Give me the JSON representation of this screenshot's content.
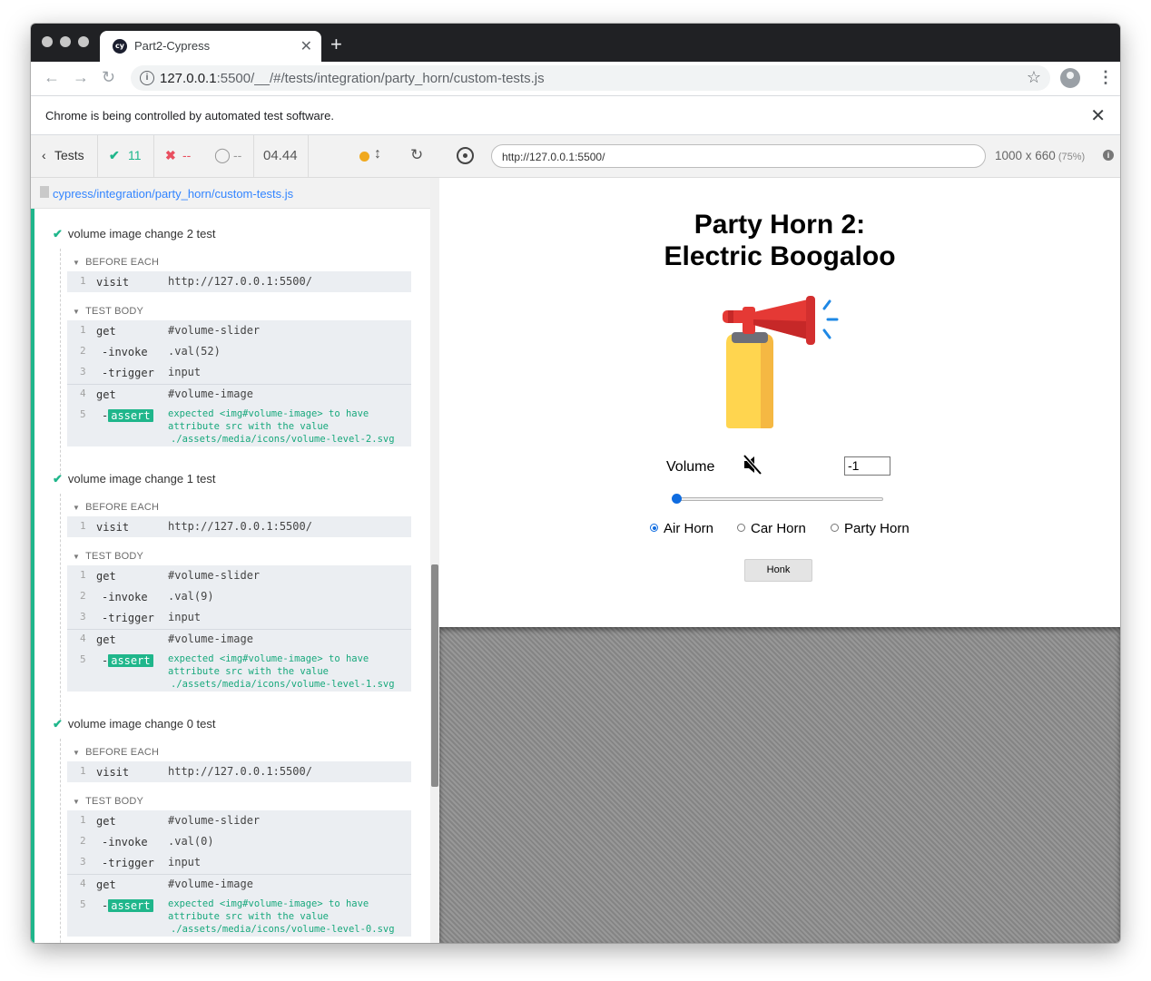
{
  "browser": {
    "tab_title": "Part2-Cypress",
    "tab_favicon": "cy",
    "url_host": "127.0.0.1",
    "url_rest": ":5500/__/#/tests/integration/party_horn/custom-tests.js",
    "infobar_text": "Chrome is being controlled by automated test software."
  },
  "reporter": {
    "back_label": "Tests",
    "passed": "11",
    "failed": "--",
    "pending": "--",
    "duration": "04.44",
    "spec_path": "cypress/integration/party_horn/custom-tests.js",
    "tests": [
      {
        "title": "volume image change 2 test",
        "before_each_label": "BEFORE EACH",
        "before_each": [
          {
            "num": "1",
            "name": "visit",
            "msg": "http://127.0.0.1:5500/"
          }
        ],
        "test_body_label": "TEST BODY",
        "body": [
          {
            "num": "1",
            "name": "get",
            "msg": "#volume-slider"
          },
          {
            "num": "2",
            "name": "-invoke",
            "msg": ".val(52)"
          },
          {
            "num": "3",
            "name": "-trigger",
            "msg": "input"
          },
          {
            "num": "4",
            "name": "get",
            "msg": "#volume-image"
          }
        ],
        "assert": {
          "num": "5",
          "dash": "-",
          "label": "assert",
          "line1": "expected <img#volume-image> to have",
          "line2": "attribute src with the value",
          "line3": "./assets/media/icons/volume-level-2.svg"
        }
      },
      {
        "title": "volume image change 1 test",
        "before_each_label": "BEFORE EACH",
        "before_each": [
          {
            "num": "1",
            "name": "visit",
            "msg": "http://127.0.0.1:5500/"
          }
        ],
        "test_body_label": "TEST BODY",
        "body": [
          {
            "num": "1",
            "name": "get",
            "msg": "#volume-slider"
          },
          {
            "num": "2",
            "name": "-invoke",
            "msg": ".val(9)"
          },
          {
            "num": "3",
            "name": "-trigger",
            "msg": "input"
          },
          {
            "num": "4",
            "name": "get",
            "msg": "#volume-image"
          }
        ],
        "assert": {
          "num": "5",
          "dash": "-",
          "label": "assert",
          "line1": "expected <img#volume-image> to have",
          "line2": "attribute src with the value",
          "line3": "./assets/media/icons/volume-level-1.svg"
        }
      },
      {
        "title": "volume image change 0 test",
        "before_each_label": "BEFORE EACH",
        "before_each": [
          {
            "num": "1",
            "name": "visit",
            "msg": "http://127.0.0.1:5500/"
          }
        ],
        "test_body_label": "TEST BODY",
        "body": [
          {
            "num": "1",
            "name": "get",
            "msg": "#volume-slider"
          },
          {
            "num": "2",
            "name": "-invoke",
            "msg": ".val(0)"
          },
          {
            "num": "3",
            "name": "-trigger",
            "msg": "input"
          },
          {
            "num": "4",
            "name": "get",
            "msg": "#volume-image"
          }
        ],
        "assert": {
          "num": "5",
          "dash": "-",
          "label": "assert",
          "line1": "expected <img#volume-image> to have",
          "line2": "attribute src with the value",
          "line3": "./assets/media/icons/volume-level-0.svg"
        }
      }
    ]
  },
  "aut": {
    "url": "http://127.0.0.1:5500/",
    "viewport": "1000 x 660",
    "scale": "(75%)",
    "title_line1": "Party Horn 2:",
    "title_line2": "Electric Boogaloo",
    "volume_label": "Volume",
    "volume_value": "-1",
    "slider_level": 0,
    "horn_options": [
      "Air Horn",
      "Car Horn",
      "Party Horn"
    ],
    "selected_horn": "Air Horn",
    "honk_label": "Honk"
  },
  "colors": {
    "pass_green": "#1fb68b",
    "fail_red": "#e94f5f",
    "link_blue": "#3385ff",
    "slider_blue": "#0f6ce0"
  },
  "icons": [
    "back-icon",
    "forward-icon",
    "reload-icon",
    "info-icon",
    "star-icon",
    "profile-icon",
    "menu-icon",
    "close-icon",
    "check-icon",
    "x-icon",
    "pending-icon",
    "reload-tests-icon",
    "selector-icon",
    "muted-volume-icon",
    "air-horn-image"
  ]
}
